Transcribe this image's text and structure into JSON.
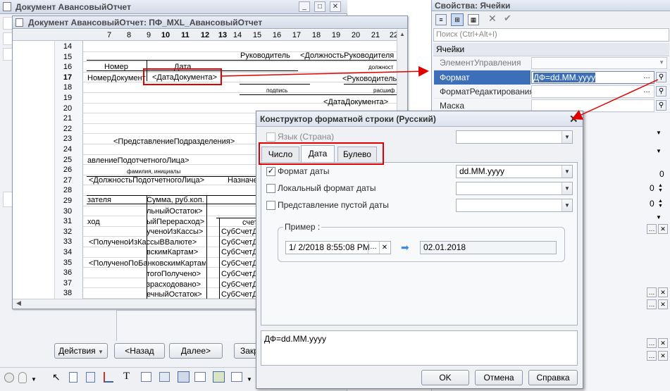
{
  "bg_window": {
    "title": "Документ АвансовыйОтчет"
  },
  "mxl_window": {
    "title": "Документ АвансовыйОтчет: ПФ_MXL_АвансовыйОтчет",
    "col_headers": [
      "7",
      "8",
      "9",
      "10",
      "11",
      "12",
      "13",
      "14",
      "15",
      "16",
      "17",
      "18",
      "19",
      "20",
      "21",
      "22"
    ],
    "row_numbers": [
      "14",
      "15",
      "16",
      "17",
      "18",
      "19",
      "20",
      "21",
      "22",
      "23",
      "24",
      "25",
      "26",
      "27",
      "28",
      "29",
      "30",
      "31",
      "32",
      "33",
      "34",
      "35",
      "36",
      "37",
      "38"
    ],
    "cells": {
      "nomer": "Номер",
      "data": "Дата",
      "rukovoditel": "Руководитель",
      "dolzhnost_ruk": "<ДолжностьРуководителя",
      "dolzhnost_small": "должност",
      "nomer_doc": "НомерДокумент",
      "data_doc": "<ДатаДокумента>",
      "ruk2": "<Руководитель",
      "podpis": "подпись",
      "rasshif": "расшиф",
      "data_doc2": "<ДатаДокумента>",
      "pred_podr": "<ПредставлениеПодразделения>",
      "pred_podot": "авлениеПодотчетногоЛица>",
      "fio": "фамилия, инициалы",
      "dolzh_podot": "<ДолжностьПодотчетногоЛица>",
      "naznach": "Назначение а",
      "r29a": "зателя",
      "r29b": "Сумма, руб.коп.",
      "r30": "льныйОстаток>",
      "r31a": "ход",
      "r31b": "ыйПерерасход>",
      "r31c": "счет, суб",
      "r32a": "ученоИзКассы>",
      "r32b": "СубСчетД",
      "r33a": "<ПолученоИзКассыВВалюте>",
      "r33b": "СубСчетД",
      "r34a": "вскимКартам>",
      "r34b": "СубСчетД",
      "r35a": "<ПолученоПоБанковскимКартам",
      "r35b": "СубСчетД",
      "r36a": "тогоПолучено>",
      "r36b": "СубСчетД",
      "r37a": "зрасходовано>",
      "r37b": "СубСчетД",
      "r38a": "ечныйОстаток>",
      "r38b": "СубСчетД"
    }
  },
  "bottom_buttons": {
    "actions": "Действия",
    "back": "<Назад",
    "next": "Далее>",
    "close": "Закр"
  },
  "properties": {
    "title": "Свойства: Ячейки",
    "search_placeholder": "Поиск (Ctrl+Alt+I)",
    "group": "Ячейки",
    "rows": [
      {
        "label": "ЭлементУправления",
        "value": ""
      },
      {
        "label": "Формат",
        "value": "ДФ=dd.MM.yyyy"
      },
      {
        "label": "ФорматРедактирования",
        "value": ""
      },
      {
        "label": "Маска",
        "value": ""
      }
    ],
    "num_values": [
      "0",
      "0",
      "0"
    ]
  },
  "dialog": {
    "title": "Конструктор форматной строки (Русский)",
    "lang_label": "Язык (Страна)",
    "tabs": [
      "Число",
      "Дата",
      "Булево"
    ],
    "active_tab": "Дата",
    "date_format_label": "Формат даты",
    "date_format_value": "dd.MM.yyyy",
    "date_format_checked": true,
    "local_format_label": "Локальный формат даты",
    "empty_date_label": "Представление пустой даты",
    "example_label": "Пример :",
    "example_input": "1/ 2/2018  8:55:08 PM",
    "example_output": "02.01.2018",
    "result": "ДФ=dd.MM.yyyy",
    "ok": "OK",
    "cancel": "Отмена",
    "help": "Справка"
  },
  "colors": {
    "highlight_red": "#e00000",
    "selection_blue": "#3d6fb8"
  }
}
